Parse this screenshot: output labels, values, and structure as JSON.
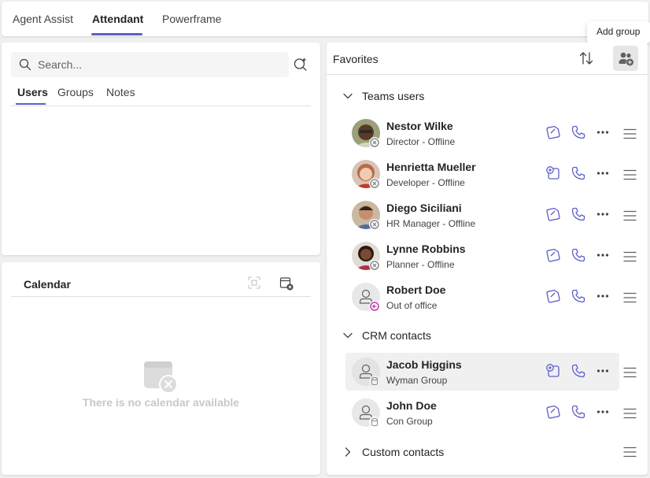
{
  "tabs": [
    {
      "label": "Agent Assist"
    },
    {
      "label": "Attendant"
    },
    {
      "label": "Powerframe"
    }
  ],
  "search": {
    "placeholder": "Search...",
    "subtabs": [
      {
        "label": "Users"
      },
      {
        "label": "Groups"
      },
      {
        "label": "Notes"
      }
    ]
  },
  "calendar": {
    "title": "Calendar",
    "empty_message": "There is no calendar available"
  },
  "favorites": {
    "title": "Favorites",
    "tooltip": "Add group",
    "groups": [
      {
        "label": "Teams users",
        "contacts": [
          {
            "name": "Nestor Wilke",
            "subtitle": "Director - Offline"
          },
          {
            "name": "Henrietta Mueller",
            "subtitle": "Developer - Offline"
          },
          {
            "name": "Diego Siciliani",
            "subtitle": "HR Manager - Offline"
          },
          {
            "name": "Lynne Robbins",
            "subtitle": "Planner - Offline"
          },
          {
            "name": "Robert Doe",
            "subtitle": "Out of office"
          }
        ]
      },
      {
        "label": "CRM contacts",
        "contacts": [
          {
            "name": "Jacob Higgins",
            "subtitle": "Wyman Group"
          },
          {
            "name": "John Doe",
            "subtitle": "Con Group"
          }
        ]
      },
      {
        "label": "Custom contacts",
        "contacts": []
      }
    ]
  },
  "colors": {
    "accent": "#5b5fc7",
    "offline": "#8a8a8a",
    "out_of_office": "#c239b3"
  }
}
